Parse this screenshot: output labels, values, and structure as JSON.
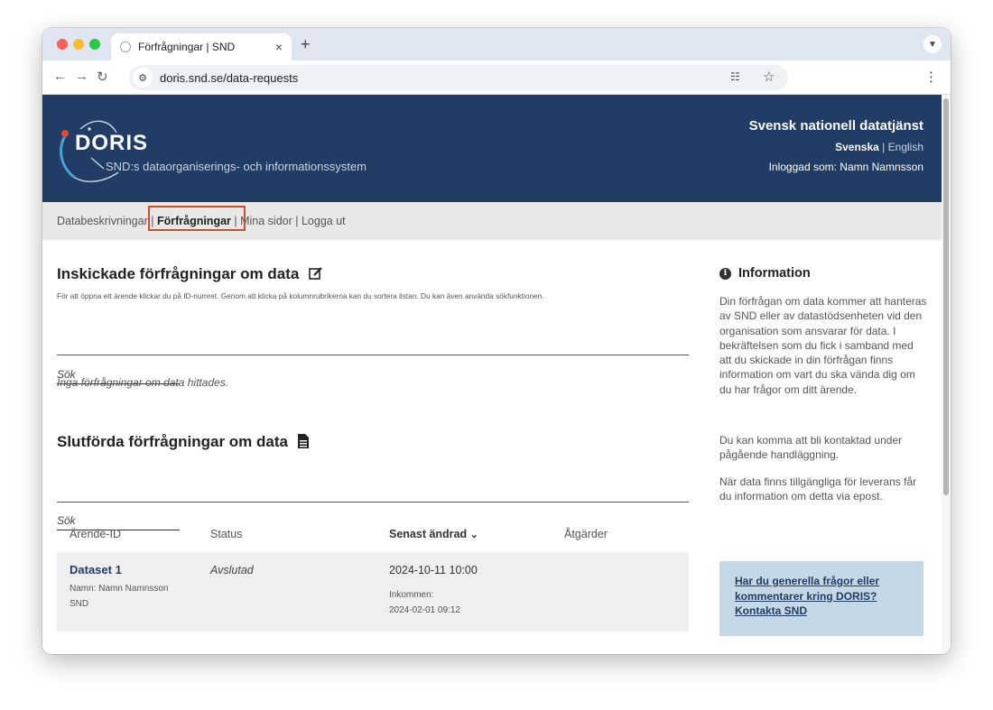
{
  "browser": {
    "tab_title": "Förfrågningar | SND",
    "tab_close": "×",
    "new_tab": "+",
    "url": "doris.snd.se/data-requests"
  },
  "header": {
    "logo_text": "DORIS",
    "logo_subtitle": "SND:s dataorganiserings- och informationssystem",
    "org_name": "Svensk nationell datatjänst",
    "lang_active": "Svenska",
    "lang_separator": "|",
    "lang_other": "English",
    "logged_in": "Inloggad som: Namn Namnsson"
  },
  "nav": {
    "item1": "Databeskrivningar",
    "sep": " | ",
    "item2": "Förfrågningar",
    "item3": "Mina sidor",
    "item4": "Logga ut"
  },
  "submitted": {
    "title": "Inskickade förfrågningar om data",
    "description": "För att öppna ett ärende klickar du på ID-numret. Genom att klicka på kolumnrubrikerna kan du sortera listan. Du kan även använda sökfunktionen.",
    "search_placeholder": "Sök",
    "empty_message": "Inga förfrågningar om data hittades."
  },
  "completed": {
    "title": "Slutförda förfrågningar om data",
    "search_placeholder": "Sök",
    "columns": {
      "id": "Ärende-ID",
      "status": "Status",
      "modified": "Senast ändrad",
      "actions": "Åtgärder"
    },
    "rows": [
      {
        "name": "Dataset 1",
        "owner": "Namn: Namn Namnsson",
        "org": "SND",
        "status": "Avslutad",
        "modified": "2024-10-11 10:00",
        "received_label": "Inkommen:",
        "received": "2024-02-01 09:12"
      }
    ]
  },
  "sidebar": {
    "title": "Information",
    "p1": "Din förfrågan om data kommer att hanteras av SND eller av datastödsenheten vid den organisation som ansvarar för data. I bekräftelsen som du fick i samband med att du skickade in din förfrågan finns information om vart du ska vända dig om du har frågor om ditt ärende.",
    "p2": "Du kan komma att bli kontaktad under pågående handläggning.",
    "p3": "När data finns tillgängliga för leverans får du information om detta via epost.",
    "contact": "Har du generella frågor eller kommentarer kring DORIS? Kontakta SND"
  },
  "colors": {
    "header_bg": "#213c65",
    "nav_bg": "#e8e8e8",
    "highlight": "#d64a2a",
    "contact_bg": "#c6d8e6"
  }
}
